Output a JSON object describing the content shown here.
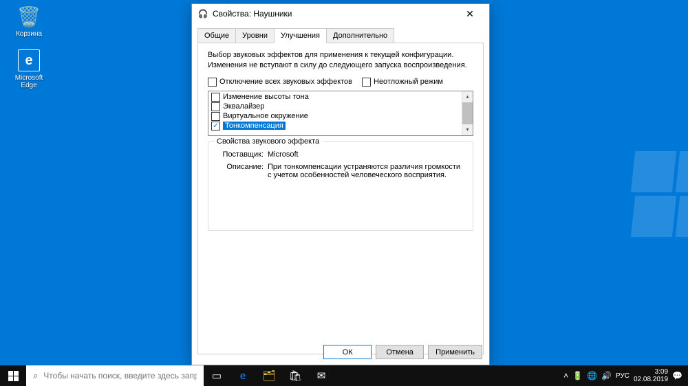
{
  "desktop": {
    "recycle": "Корзина",
    "edge": "Microsoft Edge"
  },
  "dialog": {
    "title": "Свойства: Наушники",
    "tabs": [
      "Общие",
      "Уровни",
      "Улучшения",
      "Дополнительно"
    ],
    "description": "Выбор звуковых эффектов для применения к текущей конфигурации. Изменения не вступают в силу до следующего запуска воспроизведения.",
    "disable_all": "Отключение всех звуковых эффектов",
    "immediate": "Неотложный режим",
    "effects": [
      {
        "label": "Изменение высоты тона",
        "checked": false,
        "selected": false
      },
      {
        "label": "Эквалайзер",
        "checked": false,
        "selected": false
      },
      {
        "label": "Виртуальное окружение",
        "checked": false,
        "selected": false
      },
      {
        "label": "Тонкомпенсация",
        "checked": true,
        "selected": true
      }
    ],
    "group": {
      "title": "Свойства звукового эффекта",
      "provider_label": "Поставщик:",
      "provider_value": "Microsoft",
      "desc_label": "Описание:",
      "desc_value": "При тонкомпенсации устраняются различия громкости с учетом особенностей человеческого восприятия."
    },
    "buttons": {
      "ok": "ОК",
      "cancel": "Отмена",
      "apply": "Применить"
    }
  },
  "taskbar": {
    "search_placeholder": "Чтобы начать поиск, введите здесь запрос"
  },
  "tray": {
    "lang": "РУС",
    "time": "3:09",
    "date": "02.08.2019"
  }
}
